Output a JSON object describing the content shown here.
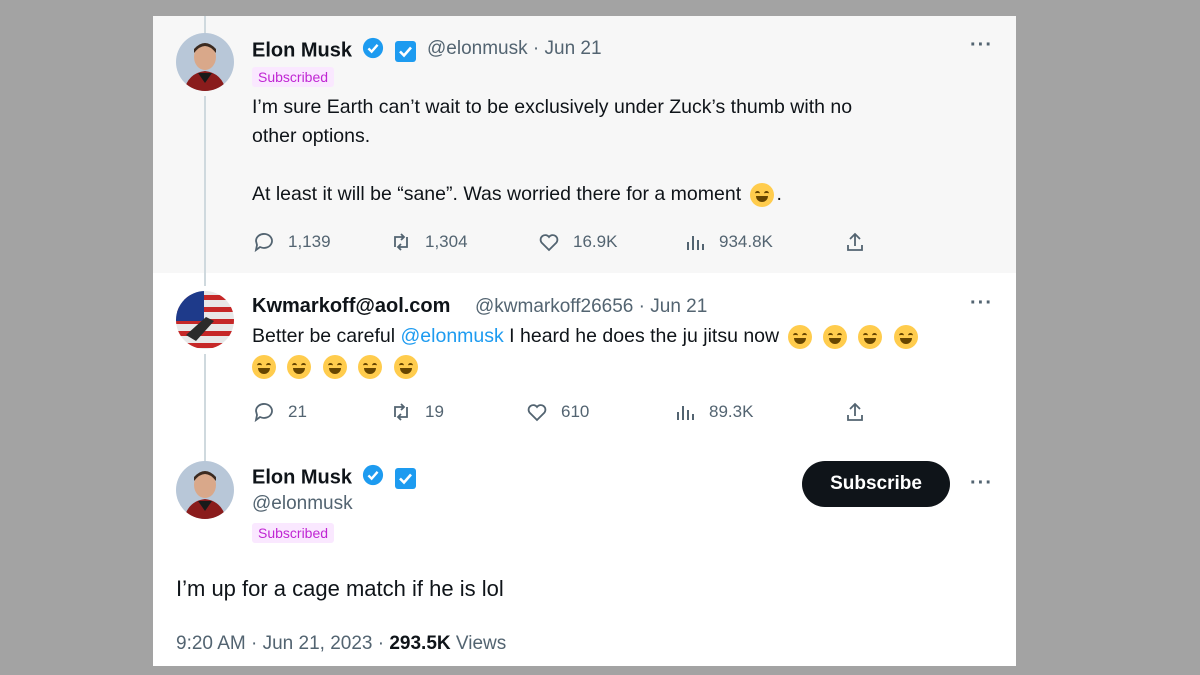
{
  "tweet1": {
    "name": "Elon Musk",
    "handle": "@elonmusk",
    "date": "· Jun 21",
    "badge": "Subscribed",
    "line1": "I’m sure Earth can’t wait to be exclusively under Zuck’s thumb with no",
    "line2": "other options.",
    "line3": "At least it will be “sane”. Was worried there for a moment",
    "line3_end": ".",
    "replies": "1,139",
    "retweets": "1,304",
    "likes": "16.9K",
    "views": "934.8K"
  },
  "tweet2": {
    "name": "Kwmarkoff@aol.com",
    "handle": "@kwmarkoff26656",
    "date": "· Jun 21",
    "text_before": "Better be careful ",
    "mention": "@elonmusk",
    "text_after": " I heard he does the ju jitsu now",
    "replies": "21",
    "retweets": "19",
    "likes": "610",
    "views": "89.3K"
  },
  "tweet3": {
    "name": "Elon Musk",
    "handle": "@elonmusk",
    "badge": "Subscribed",
    "subscribe_label": "Subscribe",
    "text": "I’m up for a cage match if he is lol",
    "time": "9:20 AM · Jun 21, 2023 · ",
    "views_count": "293.5K",
    "views_label": " Views"
  },
  "more_label": "···",
  "icons": [
    "reply-icon",
    "retweet-icon",
    "like-icon",
    "views-icon",
    "share-icon",
    "verified-icon",
    "twitter-square-icon",
    "more-icon"
  ],
  "colors": {
    "accent": "#1d9bf0",
    "badge": "#c026d3",
    "muted": "#536471"
  }
}
